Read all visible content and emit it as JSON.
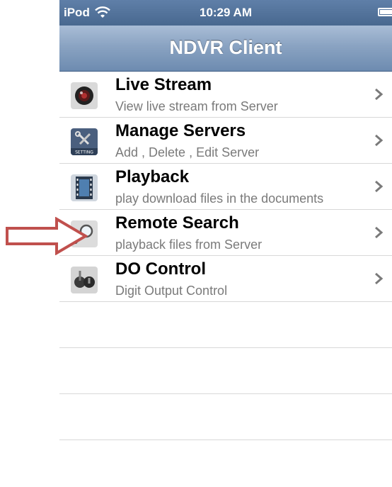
{
  "status_bar": {
    "carrier": "iPod",
    "time": "10:29 AM"
  },
  "nav": {
    "title": "NDVR Client"
  },
  "menu": {
    "items": [
      {
        "title": "Live Stream",
        "subtitle": "View live stream from Server",
        "icon": "camera-lens-icon"
      },
      {
        "title": "Manage Servers",
        "subtitle": "Add , Delete , Edit Server",
        "icon": "setting-tools-icon",
        "icon_caption": "SETTING"
      },
      {
        "title": "Playback",
        "subtitle": "play download files in the documents",
        "icon": "film-strip-icon"
      },
      {
        "title": "Remote Search",
        "subtitle": "playback files from Server",
        "icon": "magnifier-icon"
      },
      {
        "title": "DO Control",
        "subtitle": "Digit Output Control",
        "icon": "toggle-switch-icon"
      }
    ]
  },
  "annotation": {
    "arrow_color": "#c0504d",
    "points_to": "Remote Search"
  }
}
